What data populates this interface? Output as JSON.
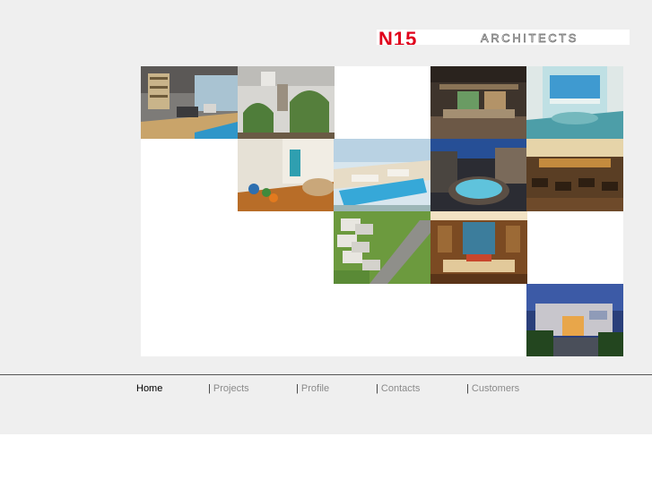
{
  "header": {
    "logo_mark": "N15",
    "logo_word": "ARCHITECTS"
  },
  "gallery": {
    "tiles": [
      {
        "row": 0,
        "col": 0,
        "subject": "Modern living room interior"
      },
      {
        "row": 0,
        "col": 1,
        "subject": "Arched interior with garden view"
      },
      {
        "row": 0,
        "col": 3,
        "subject": "Hotel lobby reception"
      },
      {
        "row": 0,
        "col": 4,
        "subject": "Pool lounge with sea view"
      },
      {
        "row": 1,
        "col": 1,
        "subject": "Curved room with wood floor"
      },
      {
        "row": 1,
        "col": 2,
        "subject": "Rooftop pool terrace"
      },
      {
        "row": 1,
        "col": 3,
        "subject": "Jacuzzi courtyard at night"
      },
      {
        "row": 1,
        "col": 4,
        "subject": "Restaurant dining hall"
      },
      {
        "row": 2,
        "col": 2,
        "subject": "Townhouse development aerial"
      },
      {
        "row": 2,
        "col": 3,
        "subject": "Hotel bedroom"
      },
      {
        "row": 3,
        "col": 4,
        "subject": "Building exterior at dusk"
      }
    ]
  },
  "nav": {
    "items": [
      {
        "sep": "",
        "label": "Home",
        "active": true
      },
      {
        "sep": "| ",
        "label": "Projects",
        "active": false
      },
      {
        "sep": "| ",
        "label": "Profile",
        "active": false
      },
      {
        "sep": "| ",
        "label": "Contacts",
        "active": false
      },
      {
        "sep": "| ",
        "label": "Customers",
        "active": false
      }
    ]
  },
  "colors": {
    "background": "#efefef",
    "logo_red": "#e0001b",
    "nav_active": "#000000",
    "nav_inactive": "#8a8a8a"
  }
}
